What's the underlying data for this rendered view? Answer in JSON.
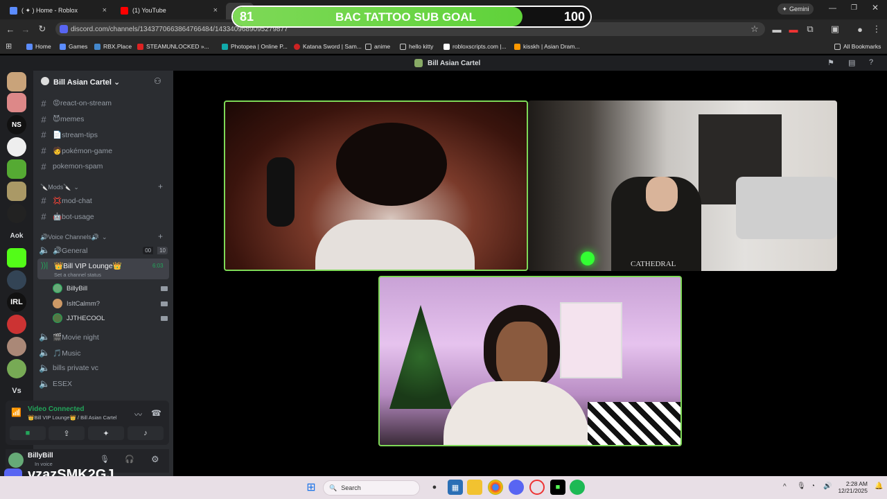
{
  "browser": {
    "tabs": [
      {
        "label": "( ✦ ) Home - Roblox"
      },
      {
        "label": "(1) YouTube"
      }
    ],
    "url": "discord.com/channels/1343770663864766484/1433409689095279877",
    "gemini_label": "Gemini",
    "bookmarks": [
      {
        "label": "Home"
      },
      {
        "label": "Games"
      },
      {
        "label": "RBX.Place"
      },
      {
        "label": "STEAMUNLOCKED »..."
      },
      {
        "label": "Photopea | Online P..."
      },
      {
        "label": "Katana Sword | Sam..."
      },
      {
        "label": "anime"
      },
      {
        "label": "hello kitty"
      },
      {
        "label": "robloxscripts.com |..."
      },
      {
        "label": "kisskh | Asian Dram..."
      }
    ],
    "all_bookmarks_label": "All Bookmarks"
  },
  "goal": {
    "current": "81",
    "title": "BAC TATTOO SUB GOAL",
    "target": "100",
    "progress": 0.81
  },
  "discord": {
    "window_title": "Bill Asian Cartel",
    "server_name": "Bill Asian Cartel",
    "server_icons": [
      {
        "label": ""
      },
      {
        "label": ""
      },
      {
        "label": "NS"
      },
      {
        "label": ""
      },
      {
        "label": ""
      },
      {
        "label": ""
      },
      {
        "label": ""
      },
      {
        "label": "Aok"
      },
      {
        "label": ""
      },
      {
        "label": ""
      },
      {
        "label": "IRL"
      },
      {
        "label": ""
      },
      {
        "label": ""
      },
      {
        "label": ""
      },
      {
        "label": "Vs"
      }
    ],
    "channels_top": [
      {
        "label": "😡react-on-stream"
      },
      {
        "label": "😈memes"
      },
      {
        "label": "📄stream-tips"
      },
      {
        "label": "🧑pokémon-game"
      },
      {
        "label": "pokemon-spam"
      }
    ],
    "mods_category": "🔪Mods🔪",
    "mod_channels": [
      {
        "label": "💢mod-chat"
      },
      {
        "label": "🤖bot-usage"
      }
    ],
    "voice_category": "🔊Voice Channels🔊",
    "voice_general": {
      "label": "🔊General",
      "count_a": "00",
      "count_b": "10"
    },
    "voice_active": {
      "label": "👑Bill VIP Lounge👑",
      "timer": "6:03",
      "status": "Set a channel status"
    },
    "voice_users": [
      {
        "name": "BillyBill"
      },
      {
        "name": "IsItCalmm?"
      },
      {
        "name": "JJTHECOOL"
      }
    ],
    "voice_others": [
      {
        "label": "🎬Movie night"
      },
      {
        "label": "🎵Music"
      },
      {
        "label": "bills private vc"
      },
      {
        "label": "ESEX"
      }
    ],
    "connection": {
      "status": "Video Connected",
      "location": "👑Bill VIP Lounge👑 / Bill Asian Cartel"
    },
    "user": {
      "name": "BillyBill",
      "status": "In voice"
    }
  },
  "video": {
    "tile1_caption": "",
    "tile2_caption": "CATHEDRAL",
    "tile3_caption": ""
  },
  "watermark": "vzazSMK2GJ",
  "taskbar": {
    "search_placeholder": "Search",
    "time": "2:28 AM",
    "date": "12/21/2025"
  }
}
